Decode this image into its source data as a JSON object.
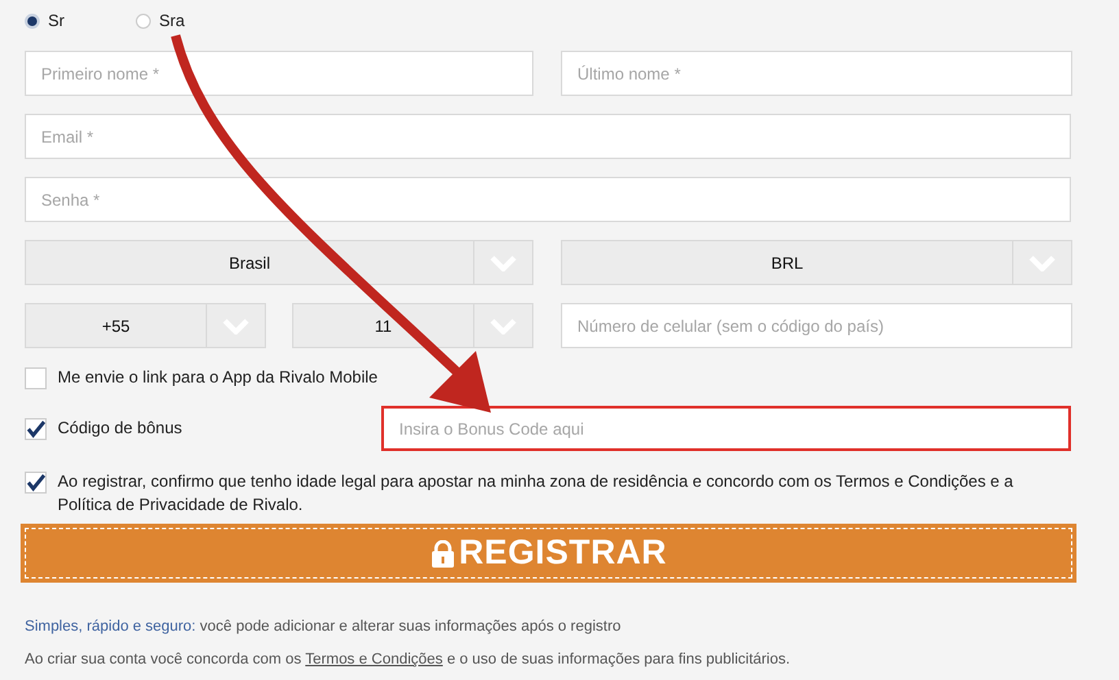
{
  "gender": [
    {
      "label": "Sr",
      "selected": true
    },
    {
      "label": "Sra",
      "selected": false
    }
  ],
  "name_fields": [
    {
      "placeholder": "Primeiro nome *"
    },
    {
      "placeholder": "Último nome *"
    }
  ],
  "email_field": {
    "placeholder": "Email *"
  },
  "password_field": {
    "placeholder": "Senha *"
  },
  "country_select": {
    "value": "Brasil"
  },
  "currency_select": {
    "value": "BRL"
  },
  "phone_code_select": {
    "value": "+55"
  },
  "area_code_select": {
    "value": "11"
  },
  "phone_field": {
    "placeholder": "Número de celular (sem o código do país)"
  },
  "app_link_checkbox": {
    "label": "Me envie o link para o App da Rivalo Mobile",
    "checked": false
  },
  "bonus_checkbox": {
    "label": "Código de bônus",
    "checked": true
  },
  "bonus_field": {
    "placeholder": "Insira o Bonus Code aqui",
    "highlighted": true
  },
  "terms_checkbox": {
    "label": "Ao registrar, confirmo que tenho idade legal para apostar na minha zona de residência e concordo com os Termos e Condições e a Política de Privacidade de Rivalo.",
    "checked": true
  },
  "register_button": {
    "label": "REGISTRAR"
  },
  "footer_notes": [
    [
      {
        "kind": "link",
        "text": "Simples, rápido e seguro:"
      },
      {
        "kind": "plain",
        "text": " você pode adicionar e alterar suas informações após o registro"
      }
    ],
    [
      {
        "kind": "plain",
        "text": "Ao criar sua conta você concorda com os "
      },
      {
        "kind": "underlined_link",
        "text": "Termos e Condições"
      },
      {
        "kind": "plain",
        "text": " e o uso de suas informações para fins publicitários."
      }
    ]
  ]
}
